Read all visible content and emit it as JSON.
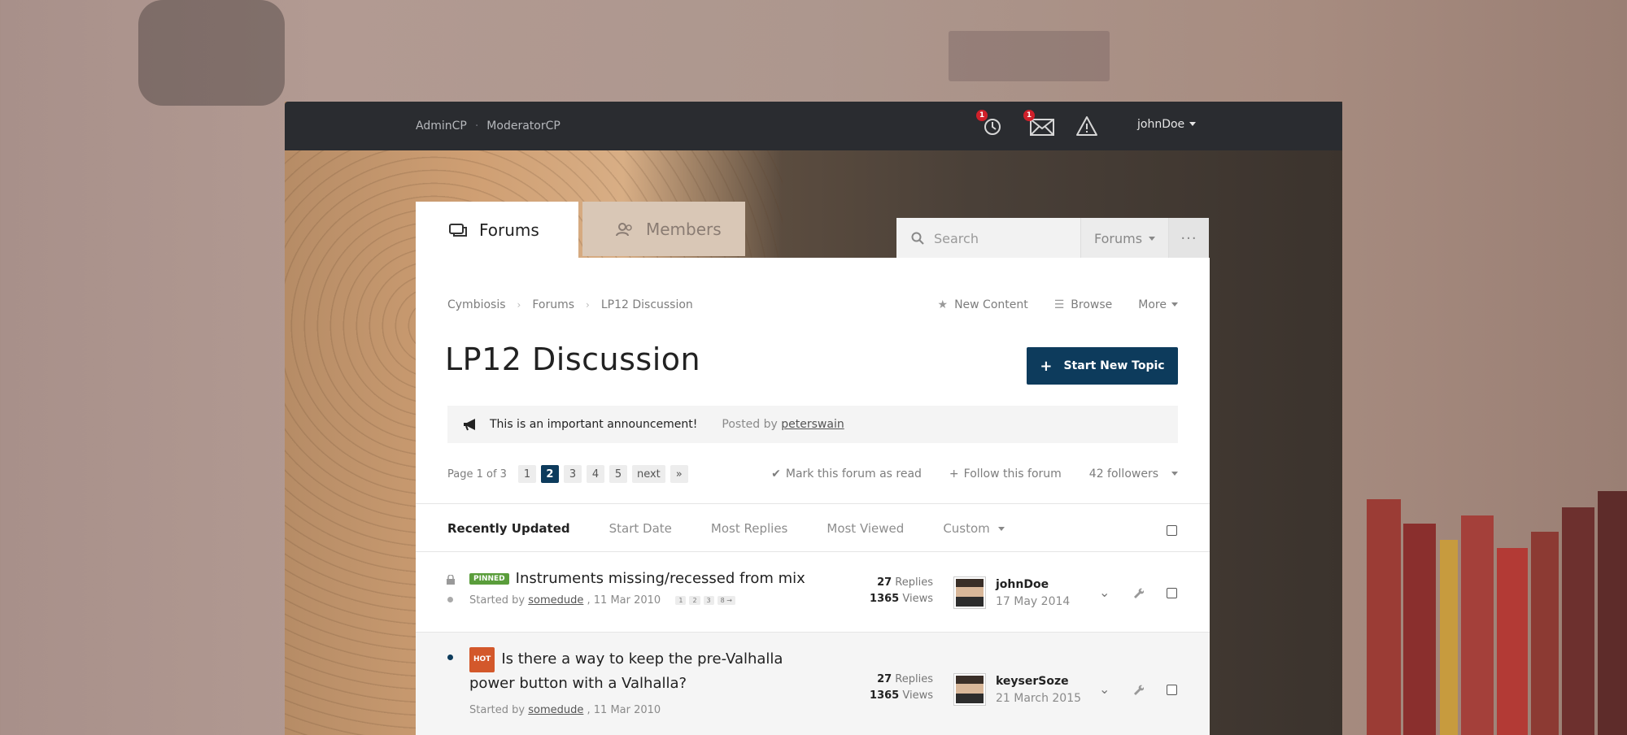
{
  "topbar": {
    "links": [
      "AdminCP",
      "ModeratorCP"
    ],
    "sep": "·",
    "notifications_badge": "1",
    "messages_badge": "1",
    "username": "johnDoe"
  },
  "tabs": [
    {
      "label": "Forums",
      "icon": "forums-icon"
    },
    {
      "label": "Members",
      "icon": "members-icon"
    }
  ],
  "search": {
    "placeholder": "Search",
    "scope": "Forums",
    "more": "···"
  },
  "breadcrumb": [
    "Cymbiosis",
    "Forums",
    "LP12 Discussion"
  ],
  "quick_links": {
    "new_content": "New Content",
    "browse": "Browse",
    "more": "More"
  },
  "page_title": "LP12 Discussion",
  "start_topic": "Start New Topic",
  "announcement": {
    "text": "This is an important announcement!",
    "posted_by": "Posted by",
    "author": "peterswain"
  },
  "pagination": {
    "label": "Page 1 of 3",
    "pages": [
      "1",
      "2",
      "3",
      "4",
      "5"
    ],
    "current": "2",
    "next": "next",
    "last": "»"
  },
  "forum_actions": {
    "mark_read": "Mark this forum as read",
    "follow": "Follow this forum",
    "followers": "42 followers"
  },
  "sort_options": [
    "Recently Updated",
    "Start Date",
    "Most Replies",
    "Most Viewed",
    "Custom"
  ],
  "topics": [
    {
      "tag": "PINNED",
      "title": "Instruments missing/recessed from mix",
      "started_by": "Started by",
      "author": "somedude",
      "date": ", 11 Mar 2010",
      "mini_pages": [
        "1",
        "2",
        "3",
        "8 →"
      ],
      "replies": "27",
      "replies_label": "Replies",
      "views": "1365",
      "views_label": "Views",
      "last_user": "johnDoe",
      "last_date": "17 May 2014"
    },
    {
      "tag": "HOT",
      "title_line1": "Is there a way to keep the pre-Valhalla",
      "title_line2": "power button with a Valhalla?",
      "started_by": "Started by",
      "author": "somedude",
      "date": ", 11 Mar 2010",
      "replies": "27",
      "replies_label": "Replies",
      "views": "1365",
      "views_label": "Views",
      "last_user": "keyserSoze",
      "last_date": "21 March 2015"
    }
  ],
  "colors": {
    "accent": "#0d3b5c",
    "topbar": "#2a2c30",
    "pinned": "#5a9d3b",
    "hot": "#d3582b",
    "badge": "#d0202a"
  }
}
